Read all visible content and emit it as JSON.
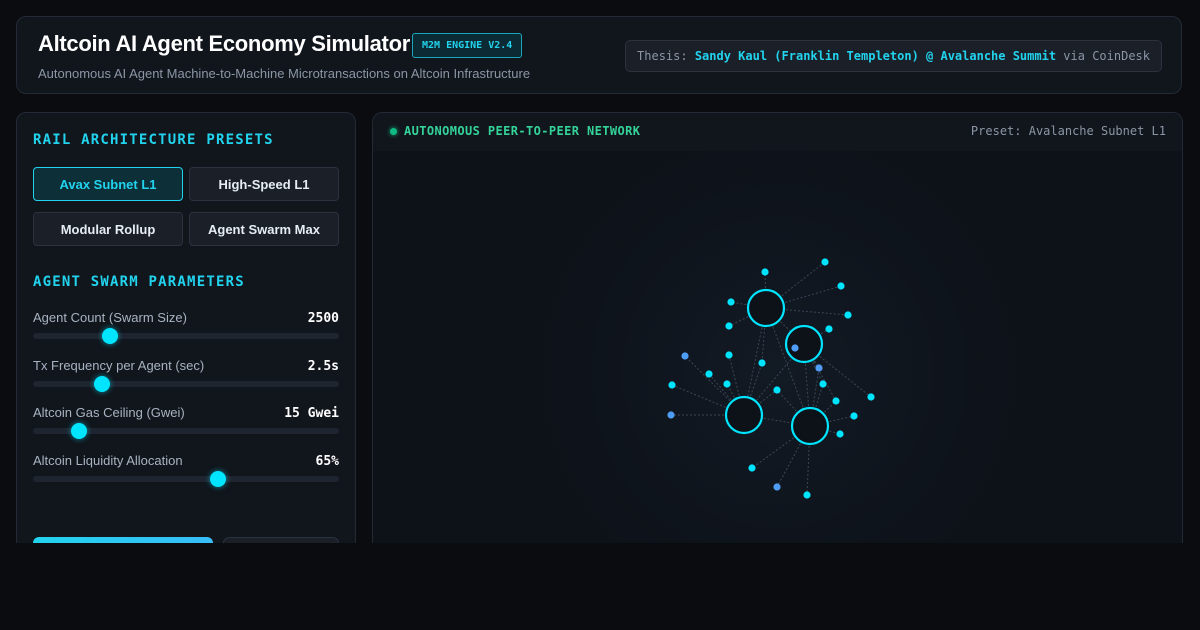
{
  "header": {
    "title": "Altcoin AI Agent Economy Simulator",
    "badge": "M2M ENGINE V2.4",
    "subtitle": "Autonomous AI Agent Machine-to-Machine Microtransactions on Altcoin Infrastructure",
    "thesis_prefix": "Thesis:",
    "thesis_highlight": "Sandy Kaul (Franklin Templeton) @ Avalanche Summit",
    "thesis_suffix": "via CoinDesk"
  },
  "presets": {
    "title": "RAIL ARCHITECTURE PRESETS",
    "items": [
      {
        "label": "Avax Subnet L1",
        "active": true
      },
      {
        "label": "High-Speed L1",
        "active": false
      },
      {
        "label": "Modular Rollup",
        "active": false
      },
      {
        "label": "Agent Swarm Max",
        "active": false
      }
    ]
  },
  "params": {
    "title": "AGENT SWARM PARAMETERS",
    "items": [
      {
        "label": "Agent Count (Swarm Size)",
        "value": "2500",
        "fraction": 0.25
      },
      {
        "label": "Tx Frequency per Agent (sec)",
        "value": "2.5s",
        "fraction": 0.225
      },
      {
        "label": "Altcoin Gas Ceiling (Gwei)",
        "value": "15 Gwei",
        "fraction": 0.15
      },
      {
        "label": "Altcoin Liquidity Allocation",
        "value": "65%",
        "fraction": 0.605
      }
    ]
  },
  "network": {
    "title": "AUTONOMOUS PEER-TO-PEER NETWORK",
    "preset_label": "Preset: Avalanche Subnet L1",
    "colors": {
      "hub": "#00e5ff",
      "node": "#00e5ff",
      "node_alt": "#4f9cf5",
      "edge": "#3a4656"
    }
  }
}
